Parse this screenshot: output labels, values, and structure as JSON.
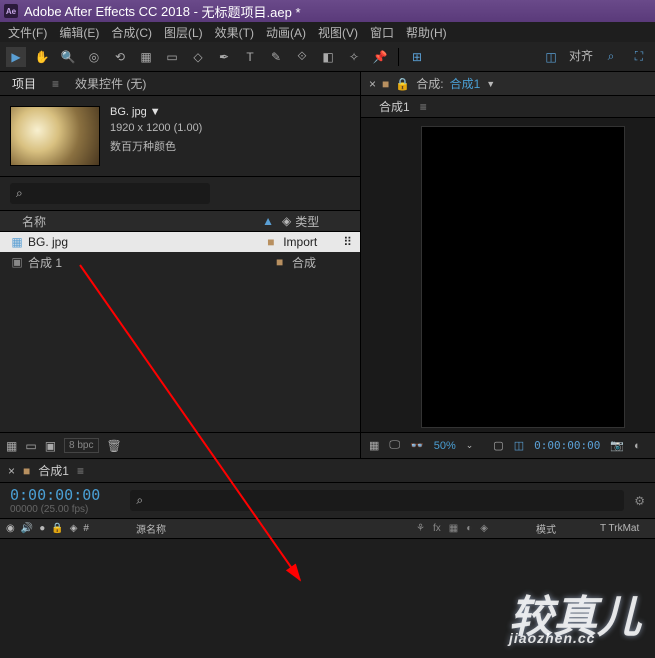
{
  "titlebar": {
    "app": "Adobe After Effects CC 2018",
    "project": "无标题项目.aep *"
  },
  "menu": [
    "文件(F)",
    "编辑(E)",
    "合成(C)",
    "图层(L)",
    "效果(T)",
    "动画(A)",
    "视图(V)",
    "窗口",
    "帮助(H)"
  ],
  "toolbar_align_label": "对齐",
  "panels": {
    "project": "项目",
    "effects": "效果控件 (无)"
  },
  "asset": {
    "name": "BG. jpg ▼",
    "dims": "1920 x 1200 (1.00)",
    "colors": "数百万种颜色"
  },
  "columns": {
    "name": "名称",
    "type": "类型"
  },
  "items": [
    {
      "name": "BG. jpg",
      "type": "Import",
      "selected": true,
      "icon": "image"
    },
    {
      "name": "合成 1",
      "type": "合成",
      "selected": false,
      "icon": "comp"
    }
  ],
  "footer": {
    "bpc": "8 bpc"
  },
  "comp": {
    "label": "合成:",
    "name": "合成1",
    "chev": "▼",
    "subtab": "合成1"
  },
  "viewer": {
    "zoom": "50%",
    "time": "0:00:00:00"
  },
  "timeline": {
    "tab": "合成1",
    "time": "0:00:00:00",
    "frames": "00000 (25.00 fps)",
    "header_src": "源名称",
    "header_mode": "模式",
    "header_trk": "T  TrkMat"
  },
  "watermark": {
    "main": "较真儿",
    "sub": "jiaozhen.cc"
  }
}
